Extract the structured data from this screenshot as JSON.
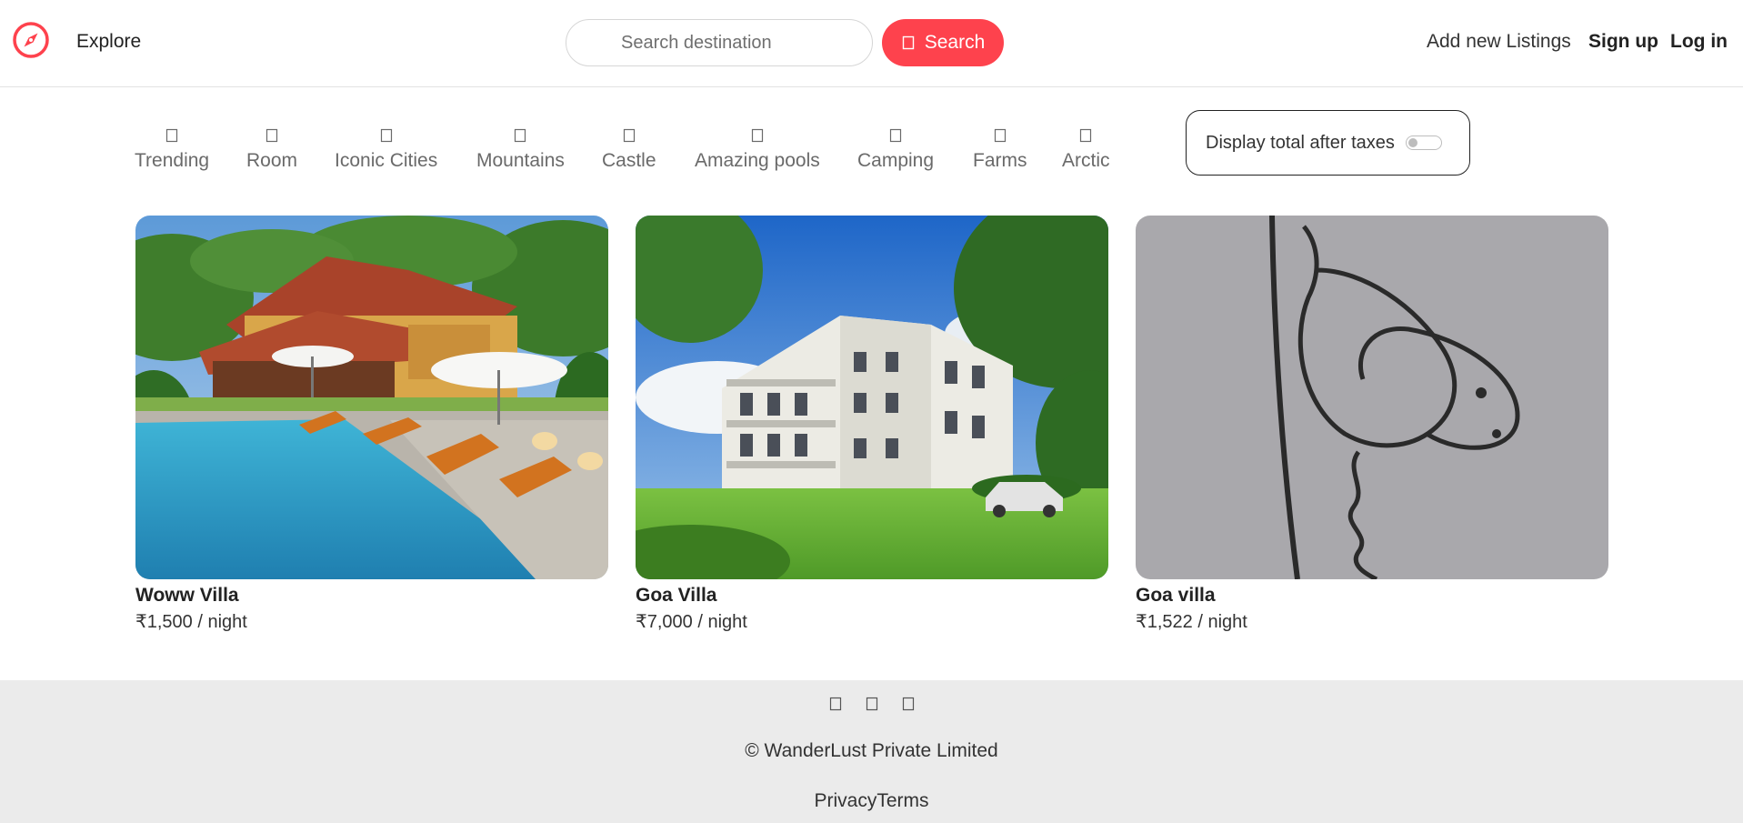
{
  "navbar": {
    "explore_label": "Explore",
    "search_placeholder": "Search destination",
    "search_button_label": "Search",
    "add_listing_label": "Add new Listings",
    "signup_label": "Sign up",
    "login_label": "Log in",
    "brand_color": "#fe424d",
    "logo_icon": "compass-icon"
  },
  "filters": [
    {
      "label": "Trending",
      "icon": "fire-icon"
    },
    {
      "label": "Room",
      "icon": "bed-icon"
    },
    {
      "label": "Iconic Cities",
      "icon": "city-icon"
    },
    {
      "label": "Mountains",
      "icon": "mountain-icon"
    },
    {
      "label": "Castle",
      "icon": "castle-icon"
    },
    {
      "label": "Amazing pools",
      "icon": "pool-icon"
    },
    {
      "label": "Camping",
      "icon": "campground-icon"
    },
    {
      "label": "Farms",
      "icon": "tractor-icon"
    },
    {
      "label": "Arctic",
      "icon": "snowflake-icon"
    }
  ],
  "tax_toggle": {
    "label": "Display total after taxes",
    "enabled": false
  },
  "listings": [
    {
      "title": "Woww Villa",
      "price": "₹1,500 / night",
      "image": "resort-pool-photo"
    },
    {
      "title": "Goa Villa",
      "price": "₹7,000 / night",
      "image": "white-apartment-building-photo"
    },
    {
      "title": "Goa villa",
      "price": "₹1,522 / night",
      "image": "handwritten-scribble-photo"
    }
  ],
  "footer": {
    "social_icons": [
      "facebook-icon",
      "instagram-icon",
      "linkedin-icon"
    ],
    "copyright": "© WanderLust Private Limited",
    "privacy_label": "Privacy",
    "terms_label": "Terms"
  }
}
